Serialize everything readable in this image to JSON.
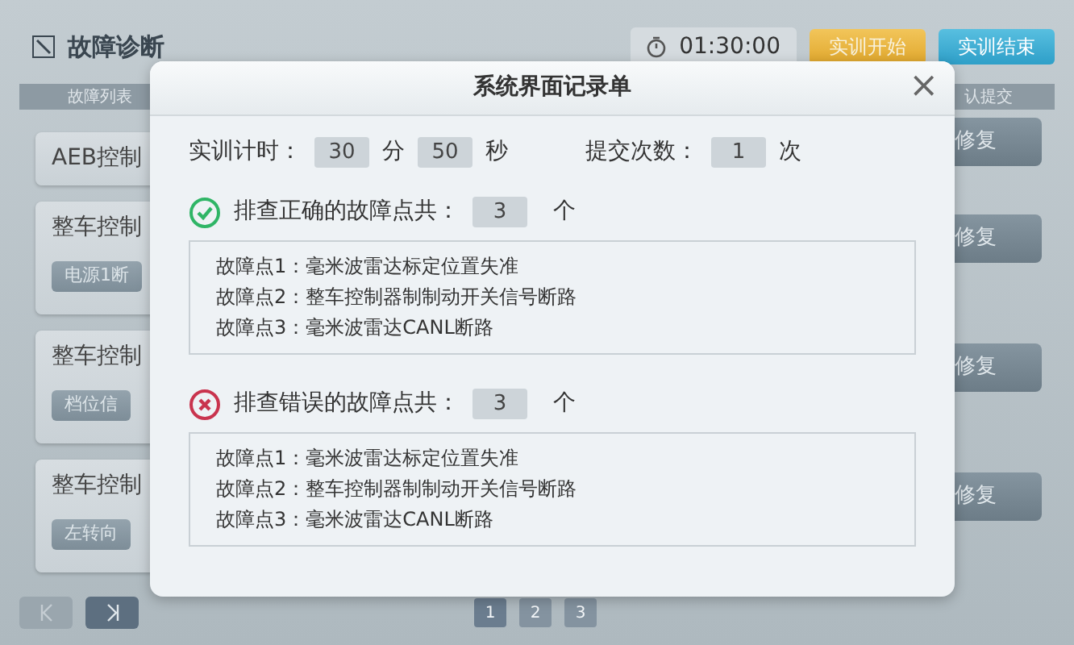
{
  "app": {
    "title": "故障诊断",
    "timer": "01:30:00",
    "buttons": [
      {
        "label": "实训开始",
        "kind": "start"
      },
      {
        "label": "实训结束",
        "kind": "end"
      }
    ],
    "list_header": "故障列表",
    "submit_header": "认提交",
    "fault_list": [
      {
        "title": "AEB控制"
      },
      {
        "title": "整车控制",
        "tag": "电源1断"
      },
      {
        "title": "整车控制",
        "tag": "档位信"
      },
      {
        "title": "整车控制",
        "tag": "左转向"
      }
    ],
    "repair_buttons": [
      "修复",
      "修复",
      "修复",
      "修复"
    ],
    "pages": [
      {
        "label": "1",
        "selected": true
      },
      {
        "label": "2",
        "selected": false
      },
      {
        "label": "3",
        "selected": false
      }
    ]
  },
  "modal": {
    "title": "系统界面记录单",
    "close": "×",
    "timing_label": "实训计时：",
    "minutes": "30",
    "minutes_unit": "分",
    "seconds": "50",
    "seconds_unit": "秒",
    "submit_label": "提交次数：",
    "submit_count": "1",
    "submit_unit": "次",
    "sections": [
      {
        "kind": "correct",
        "label": "排查正确的故障点共：",
        "count": "3",
        "unit": "个",
        "items": [
          "故障点1：毫米波雷达标定位置失准",
          "故障点2：整车控制器制制动开关信号断路",
          "故障点3：毫米波雷达CANL断路"
        ]
      },
      {
        "kind": "wrong",
        "label": "排查错误的故障点共：",
        "count": "3",
        "unit": "个",
        "items": [
          "故障点1：毫米波雷达标定位置失准",
          "故障点2：整车控制器制制动开关信号断路",
          "故障点3：毫米波雷达CANL断路"
        ]
      }
    ]
  }
}
